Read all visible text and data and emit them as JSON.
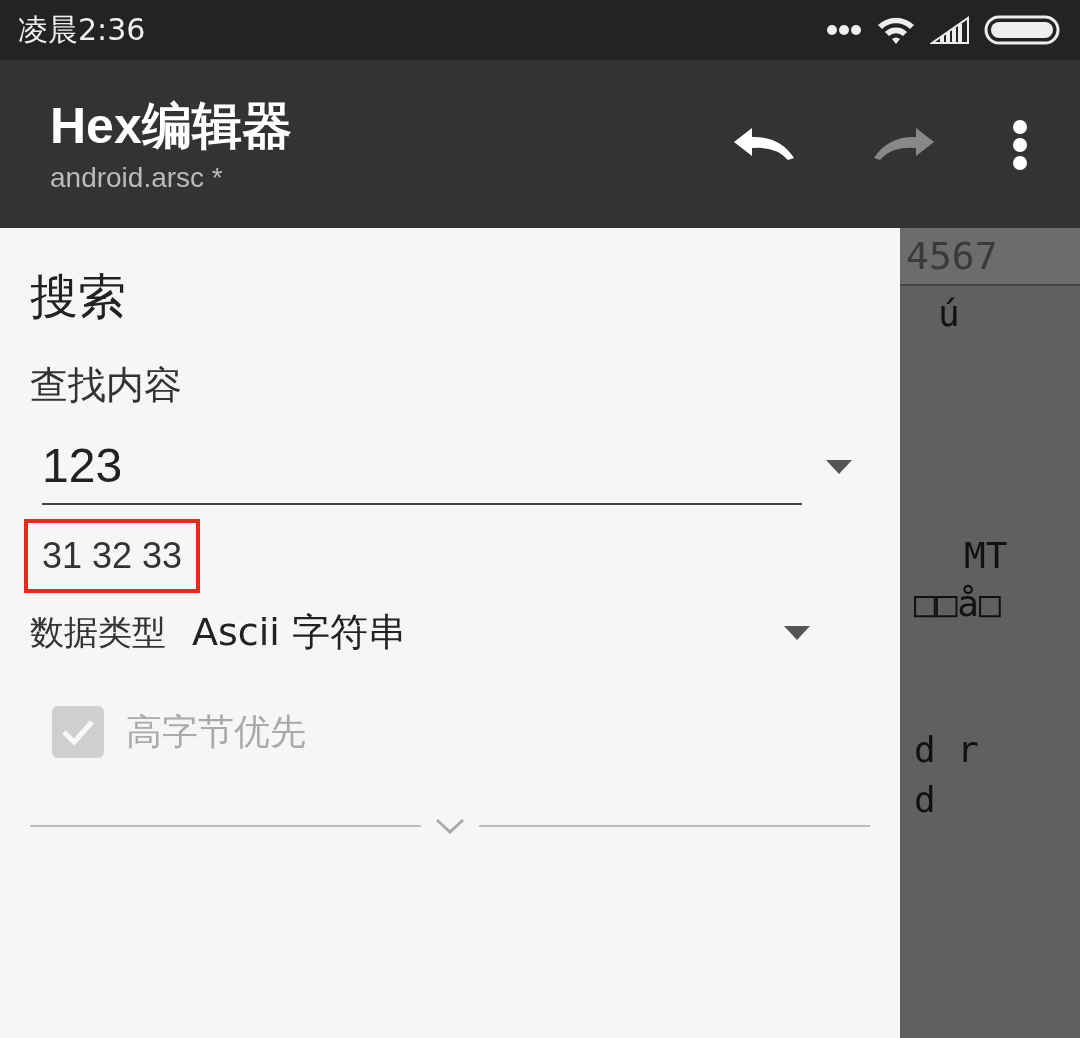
{
  "status_bar": {
    "time": "凌晨2:36"
  },
  "app_bar": {
    "title": "Hex编辑器",
    "subtitle": "android.arsc *"
  },
  "background_editor": {
    "header": "4567",
    "rows": [
      {
        "text": "ú"
      },
      {
        "text": "MT"
      },
      {
        "text": "□□å□"
      },
      {
        "text": "d r"
      },
      {
        "text": "d"
      }
    ]
  },
  "dialog": {
    "title": "搜索",
    "find_label": "查找内容",
    "query": {
      "value": "123"
    },
    "hex_preview": "31 32 33",
    "data_type": {
      "label": "数据类型",
      "value": "Ascii 字符串"
    },
    "option": {
      "label": "高字节优先",
      "checked": true,
      "disabled": true
    }
  }
}
